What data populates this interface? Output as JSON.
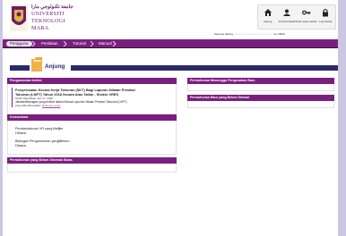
{
  "header": {
    "university": {
      "rumi": "جامعة تكنولوجي مارا",
      "lines": [
        "UNIVERSITI",
        "TEKNOLOGI",
        "MARA"
      ]
    },
    "toolbar": [
      {
        "icon": "home-icon",
        "label": "Anjung"
      },
      {
        "icon": "user-profile-icon",
        "label": "Profil Peribadi"
      },
      {
        "icon": "key-icon",
        "label": "Tukar Kata Laluan"
      },
      {
        "icon": "lock-icon",
        "label": "Log Keluar"
      }
    ],
    "welcome_prefix": "Selamat datang",
    "welcome_user": "XXXXXXXXXXXXXXXXXXXXXX",
    "welcome_suffix": "ke VRES"
  },
  "nav": {
    "items": [
      {
        "label": "Pengguna"
      },
      {
        "label": "Penilaian"
      },
      {
        "label": "Tutorial"
      },
      {
        "label": "Manual"
      }
    ]
  },
  "page": {
    "title": "Anjung"
  },
  "panels": {
    "pengumuman": {
      "title": "Pengumuman terkini",
      "item": {
        "title_line1": "Penyelesaian Secara Kerja Tahunan (SKT) Bagi Laporan Nilaian Prestasi",
        "title_line2": "Tahunan (LNPT) Tahun 2018 Secara Atas Talian - Sistem VRES",
        "date": "Tarikh Diterbitkan: Apr 27, 2018",
        "body": "Jabatan/Bahagian yang terlibat dalam Manual Laporan Nilaian Prestasi Tahunan (LNPT)",
        "footer": "yang telah dikemaskini.",
        "more": "Maklumat Lanjut"
      }
    },
    "komunikasi": {
      "title": "Komunikasi",
      "rows": [
        {
          "label_line1": "Pemberitahuan VR yang Belum",
          "label_line2": "Dibaca",
          "value": "2"
        },
        {
          "label_line1": "Bilangan Pengumuman yang Belum",
          "label_line2": "Dibaca",
          "value": "0"
        }
      ]
    },
    "permohonan_semak": {
      "title": "Permohonan yang Belum Disemak Balas"
    },
    "permohonan_sokongan": {
      "title": "Permohonan Menunggu Pengesahan Baru"
    },
    "bayaran": {
      "title": "Permohonan Baru yang Belum Selesai"
    }
  },
  "colors": {
    "brand_purple": "#7b1f7f",
    "title_navy": "#2a2a6a",
    "frame_lavender": "#cbc7e3"
  }
}
